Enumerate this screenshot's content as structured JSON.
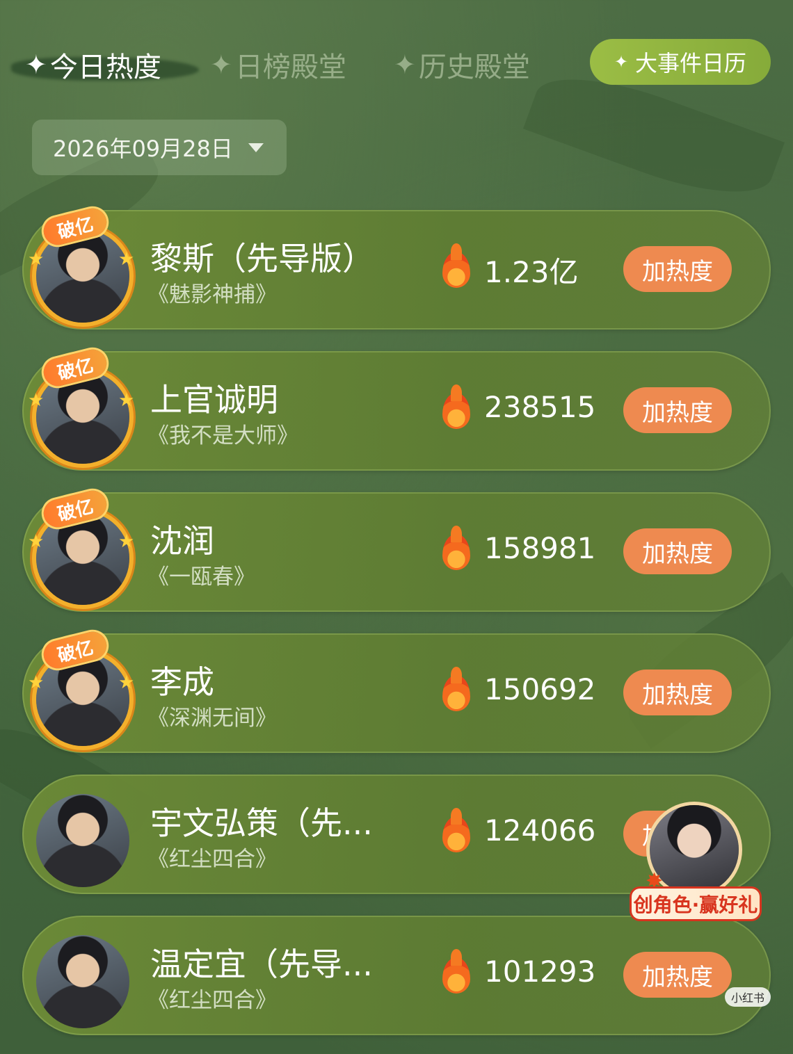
{
  "tabs": [
    {
      "label": "今日热度",
      "active": true
    },
    {
      "label": "日榜殿堂",
      "active": false
    },
    {
      "label": "历史殿堂",
      "active": false
    }
  ],
  "calendar_button": "大事件日历",
  "date": "2026年09月28日",
  "rows": [
    {
      "name": "黎斯（先导版）",
      "drama": "《魅影神捕》",
      "heat": "1.23亿",
      "badge": "破亿",
      "button": "加热度"
    },
    {
      "name": "上官诚明",
      "drama": "《我不是大师》",
      "heat": "238515",
      "badge": "破亿",
      "button": "加热度"
    },
    {
      "name": "沈润",
      "drama": "《一瓯春》",
      "heat": "158981",
      "badge": "破亿",
      "button": "加热度"
    },
    {
      "name": "李成",
      "drama": "《深渊无间》",
      "heat": "150692",
      "badge": "破亿",
      "button": "加热度"
    },
    {
      "name": "宇文弘策（先...",
      "drama": "《红尘四合》",
      "heat": "124066",
      "badge": "",
      "button": "加热度"
    },
    {
      "name": "温定宜（先导...",
      "drama": "《红尘四合》",
      "heat": "101293",
      "badge": "",
      "button": "加热度"
    }
  ],
  "promo": {
    "label": "创角色·赢好礼"
  },
  "watermark": "小红书",
  "colors": {
    "accent_green": "#9bbd45",
    "button_orange": "#ee8a50",
    "badge_orange": "#ff7b2c"
  }
}
